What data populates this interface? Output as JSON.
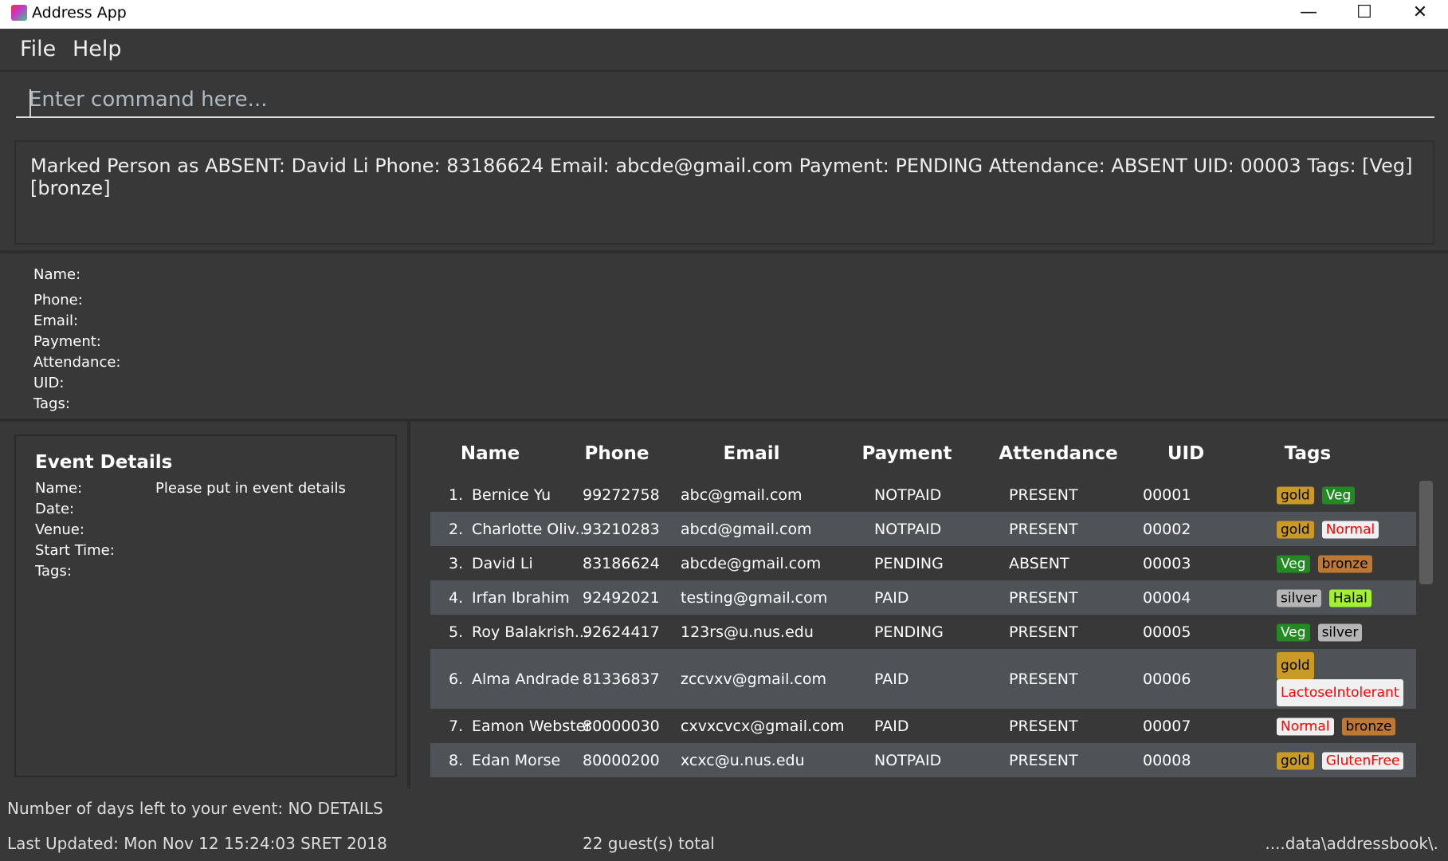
{
  "window": {
    "title": "Address App",
    "controls": [
      "minimize",
      "maximize",
      "close"
    ]
  },
  "menu": [
    "File",
    "Help"
  ],
  "command": {
    "placeholder": "Enter command here...",
    "value": ""
  },
  "result": "Marked Person as ABSENT: David Li Phone: 83186624 Email: abcde@gmail.com Payment: PENDING Attendance: ABSENT UID: 00003 Tags: [Veg][bronze]",
  "person_labels": [
    "Name:",
    "Phone:",
    "Email:",
    "Payment:",
    "Attendance:",
    "UID:",
    "Tags:"
  ],
  "event": {
    "title": "Event Details",
    "labels": [
      "Name:",
      "Date:",
      "Venue:",
      "Start Time:",
      "Tags:"
    ],
    "name_value": "Please put in event details"
  },
  "table": {
    "headers": [
      "Name",
      "Phone",
      "Email",
      "Payment",
      "Attendance",
      "UID",
      "Tags"
    ],
    "rows": [
      {
        "num": "1.",
        "name": "Bernice Yu",
        "phone": "99272758",
        "email": "abc@gmail.com",
        "payment": "NOTPAID",
        "attendance": "PRESENT",
        "uid": "00001",
        "tags": [
          {
            "t": "gold",
            "bg": "#c99a25",
            "fg": "#000"
          },
          {
            "t": "Veg",
            "bg": "#238a23",
            "fg": "#fff"
          }
        ]
      },
      {
        "num": "2.",
        "name": "Charlotte Oliv...",
        "phone": "93210283",
        "email": "abcd@gmail.com",
        "payment": "NOTPAID",
        "attendance": "PRESENT",
        "uid": "00002",
        "tags": [
          {
            "t": "gold",
            "bg": "#c99a25",
            "fg": "#000"
          },
          {
            "t": "Normal",
            "bg": "#f0f0f0",
            "fg": "#ff0000"
          }
        ]
      },
      {
        "num": "3.",
        "name": "David Li",
        "phone": "83186624",
        "email": "abcde@gmail.com",
        "payment": "PENDING",
        "attendance": "ABSENT",
        "uid": "00003",
        "tags": [
          {
            "t": "Veg",
            "bg": "#238a23",
            "fg": "#fff"
          },
          {
            "t": "bronze",
            "bg": "#bd7833",
            "fg": "#000"
          }
        ]
      },
      {
        "num": "4.",
        "name": "Irfan Ibrahim",
        "phone": "92492021",
        "email": "testing@gmail.com",
        "payment": "PAID",
        "attendance": "PRESENT",
        "uid": "00004",
        "tags": [
          {
            "t": "silver",
            "bg": "#b5b5b5",
            "fg": "#000"
          },
          {
            "t": "Halal",
            "bg": "#a2f032",
            "fg": "#000"
          }
        ]
      },
      {
        "num": "5.",
        "name": "Roy Balakrish...",
        "phone": "92624417",
        "email": "123rs@u.nus.edu",
        "payment": "PENDING",
        "attendance": "PRESENT",
        "uid": "00005",
        "tags": [
          {
            "t": "Veg",
            "bg": "#238a23",
            "fg": "#fff"
          },
          {
            "t": "silver",
            "bg": "#b5b5b5",
            "fg": "#000"
          }
        ]
      },
      {
        "num": "6.",
        "name": "Alma Andrade",
        "phone": "81336837",
        "email": "zccvxv@gmail.com",
        "payment": "PAID",
        "attendance": "PRESENT",
        "uid": "00006",
        "tags": [
          {
            "t": "gold",
            "bg": "#c99a25",
            "fg": "#000"
          },
          {
            "t": "LactoseIntolerant",
            "bg": "#f0f0f0",
            "fg": "#ff0000"
          }
        ]
      },
      {
        "num": "7.",
        "name": "Eamon Webster",
        "phone": "80000030",
        "email": "cxvxcvcx@gmail.com",
        "payment": "PAID",
        "attendance": "PRESENT",
        "uid": "00007",
        "tags": [
          {
            "t": "Normal",
            "bg": "#f0f0f0",
            "fg": "#ff0000"
          },
          {
            "t": "bronze",
            "bg": "#bd7833",
            "fg": "#000"
          }
        ]
      },
      {
        "num": "8.",
        "name": "Edan Morse",
        "phone": "80000200",
        "email": "xcxc@u.nus.edu",
        "payment": "NOTPAID",
        "attendance": "PRESENT",
        "uid": "00008",
        "tags": [
          {
            "t": "gold",
            "bg": "#c99a25",
            "fg": "#000"
          },
          {
            "t": "GlutenFree",
            "bg": "#f0f0f0",
            "fg": "#ff0000"
          }
        ]
      }
    ]
  },
  "footer": {
    "days_left": "Number of days left to your event: NO DETAILS",
    "last_updated": "Last Updated: Mon Nov 12 15:24:03 SRET 2018",
    "total": "22 guest(s) total",
    "path": "....data\\addressbook\\."
  }
}
